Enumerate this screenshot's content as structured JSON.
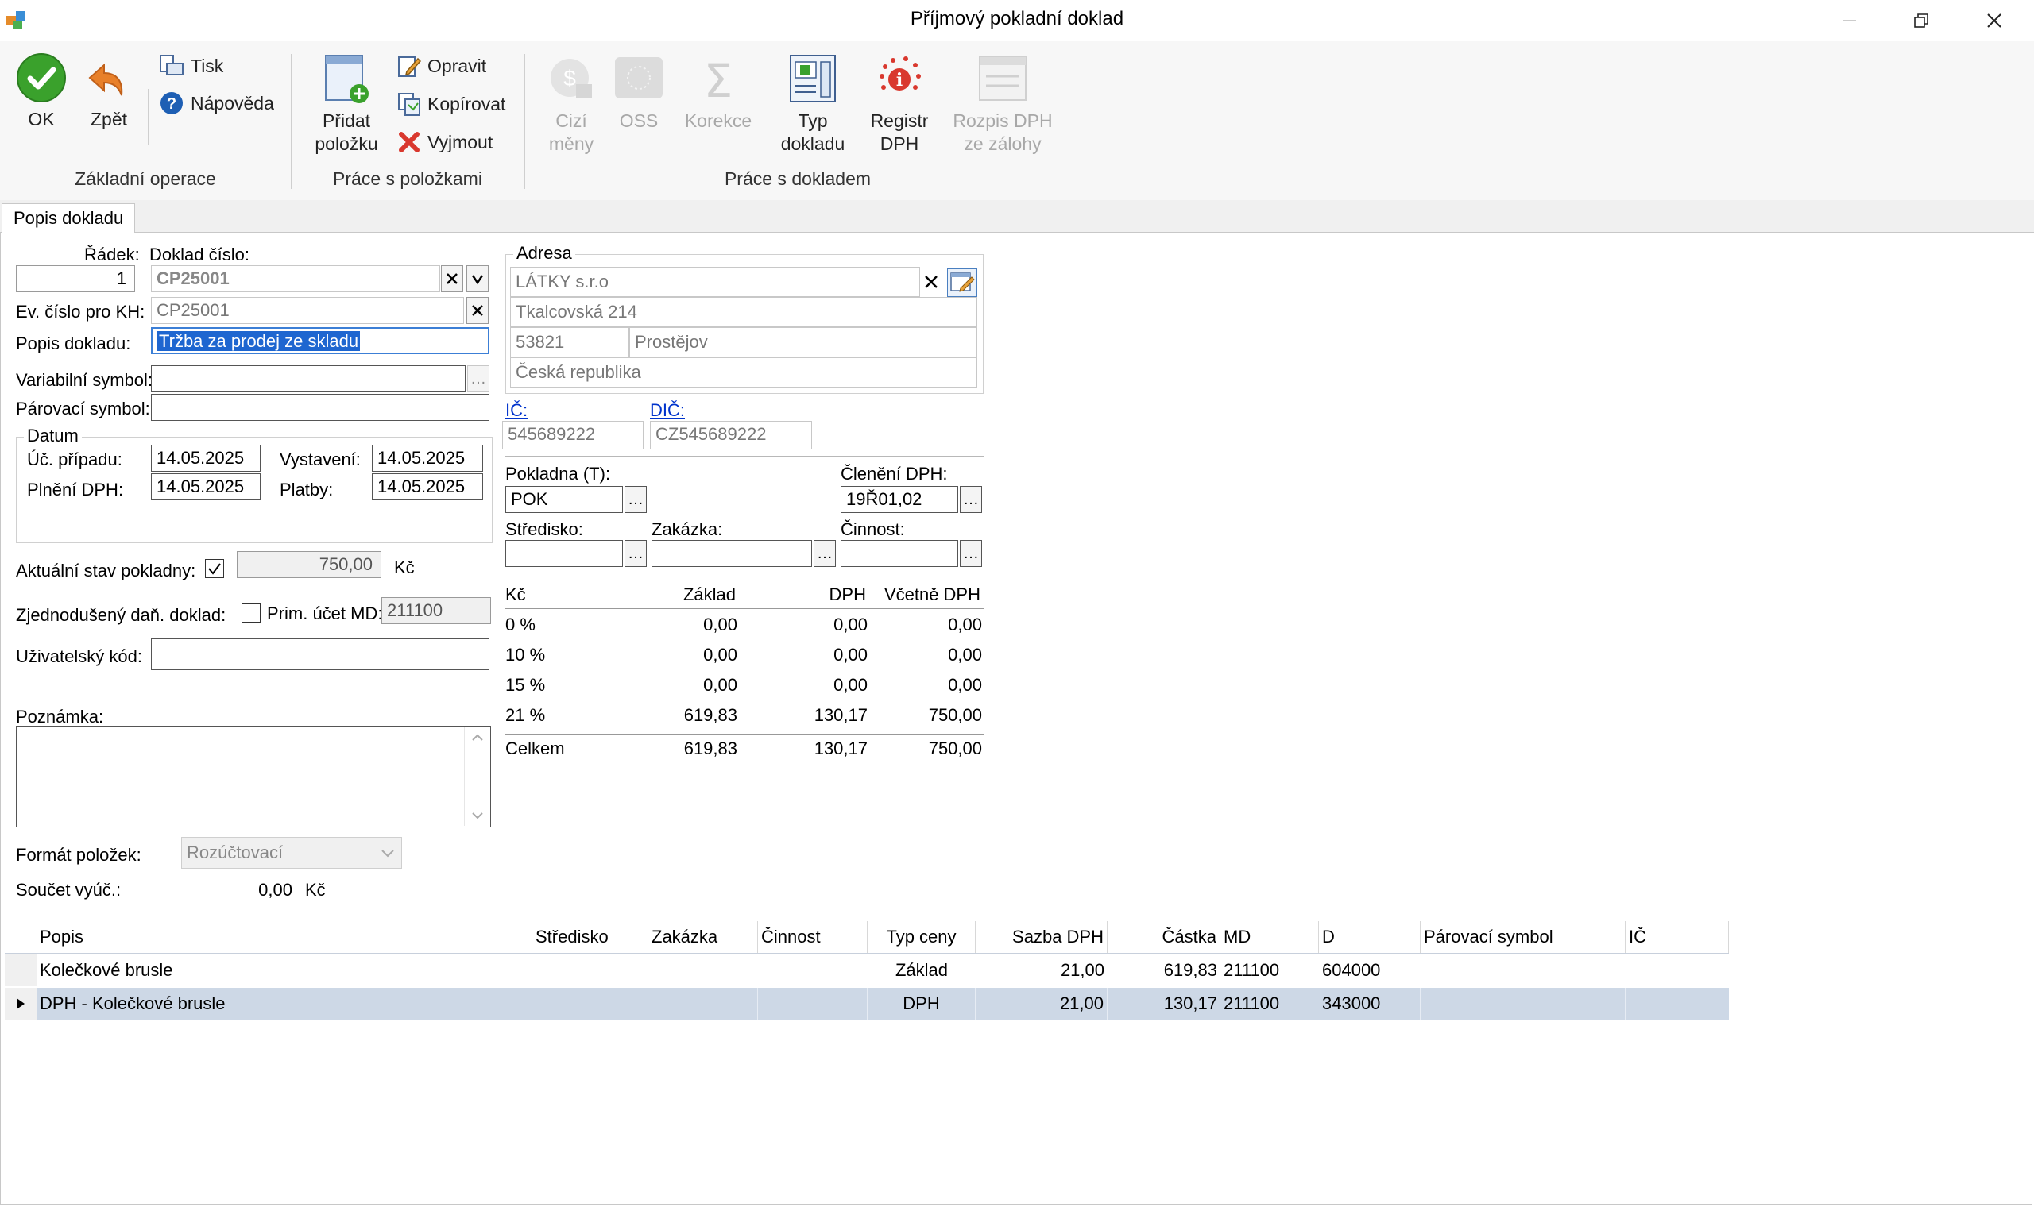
{
  "window": {
    "title": "Příjmový pokladní doklad"
  },
  "ribbon": {
    "ok": "OK",
    "back": "Zpět",
    "print": "Tisk",
    "help": "Nápověda",
    "add_item_1": "Přidat",
    "add_item_2": "položku",
    "edit": "Opravit",
    "copy": "Kopírovat",
    "cut": "Vyjmout",
    "foreign_1": "Cizí",
    "foreign_2": "měny",
    "oss": "OSS",
    "correction": "Korekce",
    "doctype_1": "Typ",
    "doctype_2": "dokladu",
    "registry_1": "Registr",
    "registry_2": "DPH",
    "vat_split_1": "Rozpis DPH",
    "vat_split_2": "ze zálohy",
    "group_basic": "Základní operace",
    "group_items": "Práce s položkami",
    "group_doc": "Práce s dokladem"
  },
  "tab": {
    "label": "Popis dokladu"
  },
  "form": {
    "row_label": "Řádek:",
    "row_value": "1",
    "doc_no_label": "Doklad číslo:",
    "doc_no_value": "CP25001",
    "ev_label": "Ev. číslo pro KH:",
    "ev_value": "CP25001",
    "desc_label": "Popis dokladu:",
    "desc_value": "Tržba za prodej ze skladu",
    "var_sym_label": "Variabilní symbol:",
    "var_sym_value": "",
    "pair_sym_label": "Párovací symbol:",
    "pair_sym_value": "",
    "date_legend": "Datum",
    "acc_date_label": "Úč. případu:",
    "acc_date_value": "14.05.2025",
    "issue_label": "Vystavení:",
    "issue_value": "14.05.2025",
    "vat_date_label": "Plnění DPH:",
    "vat_date_value": "14.05.2025",
    "pay_label": "Platby:",
    "pay_value": "14.05.2025",
    "cash_state_label": "Aktuální stav pokladny:",
    "cash_state_value": "750,00",
    "cash_state_currency": "Kč",
    "simplified_label": "Zjednodušený daň. doklad:",
    "prim_acc_label": "Prim. účet MD:",
    "prim_acc_value": "211100",
    "user_code_label": "Uživatelský kód:",
    "user_code_value": "",
    "note_label": "Poznámka:",
    "note_value": "",
    "item_format_label": "Formát položek:",
    "item_format_value": "Rozúčtovací",
    "sum_label": "Součet vyúč.:",
    "sum_value": "0,00",
    "sum_currency": "Kč"
  },
  "address": {
    "legend": "Adresa",
    "name": "LÁTKY s.r.o",
    "street": "Tkalcovská 214",
    "zip": "53821",
    "city": "Prostějov",
    "country": "Česká republika",
    "ic_label": "IČ:",
    "ic_value": "545689222",
    "dic_label": "DIČ:",
    "dic_value": "CZ545689222"
  },
  "cash": {
    "register_label": "Pokladna (T):",
    "register_value": "POK",
    "vat_class_label": "Členění DPH:",
    "vat_class_value": "19Ř01,02",
    "center_label": "Středisko:",
    "order_label": "Zakázka:",
    "activity_label": "Činnost:"
  },
  "vat_table": {
    "headers": [
      "Kč",
      "Základ",
      "DPH",
      "Včetně DPH"
    ],
    "rows": [
      [
        "0 %",
        "0,00",
        "0,00",
        "0,00"
      ],
      [
        "10 %",
        "0,00",
        "0,00",
        "0,00"
      ],
      [
        "15 %",
        "0,00",
        "0,00",
        "0,00"
      ],
      [
        "21 %",
        "619,83",
        "130,17",
        "750,00"
      ]
    ],
    "total": [
      "Celkem",
      "619,83",
      "130,17",
      "750,00"
    ]
  },
  "grid": {
    "headers": [
      "Popis",
      "Středisko",
      "Zakázka",
      "Činnost",
      "Typ ceny",
      "Sazba DPH",
      "Částka",
      "MD",
      "D",
      "Párovací symbol",
      "IČ"
    ],
    "rows": [
      [
        "Kolečkové brusle",
        "",
        "",
        "",
        "Základ",
        "21,00",
        "619,83",
        "211100",
        "604000",
        "",
        ""
      ],
      [
        "DPH - Kolečkové brusle",
        "",
        "",
        "",
        "DPH",
        "21,00",
        "130,17",
        "211100",
        "343000",
        "",
        ""
      ]
    ]
  },
  "colors": {
    "selected_row": "#cdd8e6",
    "link": "#0033cc",
    "ok_green": "#3aa12c",
    "back_orange": "#e8802a"
  }
}
